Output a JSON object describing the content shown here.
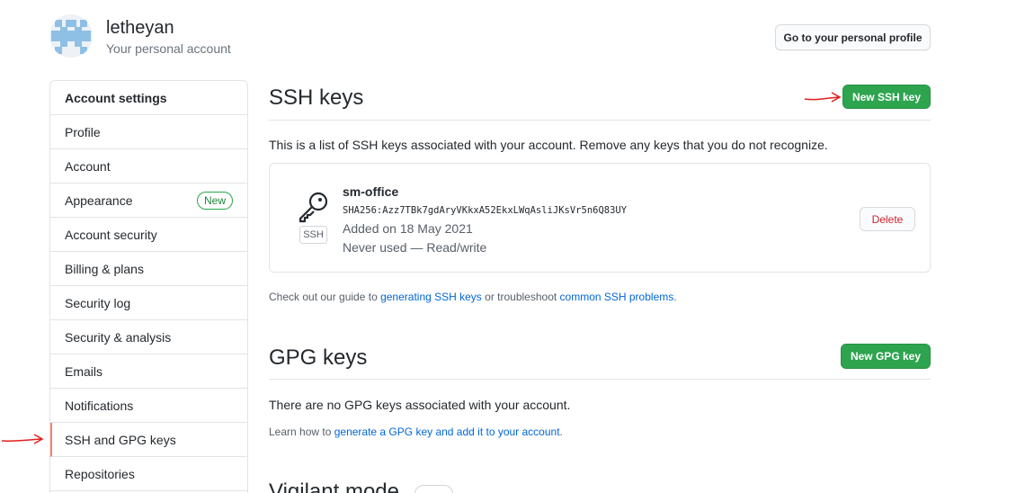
{
  "header": {
    "username": "letheyan",
    "subtitle": "Your personal account",
    "profile_button": "Go to your personal profile"
  },
  "sidebar": {
    "title": "Account settings",
    "items": [
      {
        "label": "Profile"
      },
      {
        "label": "Account"
      },
      {
        "label": "Appearance",
        "badge": "New"
      },
      {
        "label": "Account security"
      },
      {
        "label": "Billing & plans"
      },
      {
        "label": "Security log"
      },
      {
        "label": "Security & analysis"
      },
      {
        "label": "Emails"
      },
      {
        "label": "Notifications"
      },
      {
        "label": "SSH and GPG keys",
        "selected": true
      },
      {
        "label": "Repositories"
      }
    ]
  },
  "ssh": {
    "title": "SSH keys",
    "new_button": "New SSH key",
    "description": "This is a list of SSH keys associated with your account. Remove any keys that you do not recognize.",
    "key": {
      "name": "sm-office",
      "fingerprint": "SHA256:Azz7TBk7gdAryVKkxA52EkxLWqAsliJKsVr5n6Q83UY",
      "added": "Added on 18 May 2021",
      "usage": "Never used — Read/write",
      "type_label": "SSH",
      "delete_button": "Delete"
    },
    "guide_prefix": "Check out our guide to ",
    "guide_link1": "generating SSH keys",
    "guide_middle": " or troubleshoot ",
    "guide_link2": "common SSH problems",
    "guide_suffix": "."
  },
  "gpg": {
    "title": "GPG keys",
    "new_button": "New GPG key",
    "empty_text": "There are no GPG keys associated with your account.",
    "learn_prefix": "Learn how to ",
    "learn_link": "generate a GPG key and add it to your account",
    "learn_suffix": "."
  },
  "vigilant": {
    "title": "Vigilant mode"
  },
  "colors": {
    "primary": "#2ea44f",
    "link": "#0366d6",
    "danger": "#cb2431",
    "selected_marker": "#f9826c",
    "annotation_arrow": "#e0201c"
  }
}
